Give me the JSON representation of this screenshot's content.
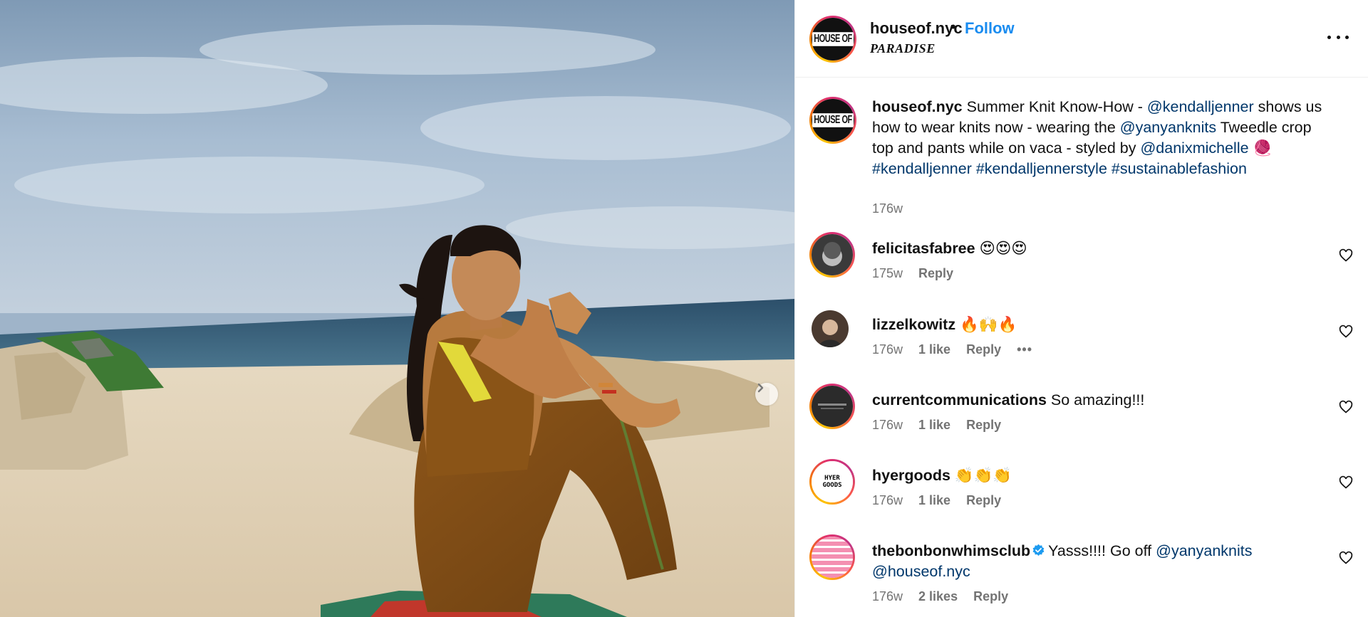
{
  "post": {
    "author": "houseof.nyc",
    "follow_label": "Follow",
    "separator": "•",
    "location": "PARADISE",
    "logo_text": "HOUSE OF",
    "more_icon": "more-horizontal-icon",
    "next_icon": "chevron-right-icon"
  },
  "caption": {
    "username": "houseof.nyc",
    "text_1": "Summer Knit Know-How - ",
    "mention_1": "@kendalljenner",
    "text_2": " shows us how to wear knits now - wearing the ",
    "mention_2": "@yanyanknits",
    "text_3": " Tweedle crop top and pants while on vaca - styled by ",
    "mention_3": "@danixmichelle",
    "emoji": "🧶",
    "hashtag_1": "#kendalljenner",
    "hashtag_2": "#kendalljennerstyle",
    "hashtag_3": "#sustainablefashion",
    "time": "176w"
  },
  "comments": [
    {
      "username": "felicitasfabree",
      "text": "😍😍😍",
      "time": "175w",
      "likes": "",
      "reply": "Reply"
    },
    {
      "username": "lizzelkowitz",
      "text": "🔥🙌🔥",
      "time": "176w",
      "likes": "1 like",
      "reply": "Reply",
      "more": "•••"
    },
    {
      "username": "currentcommunications",
      "text": "So amazing!!!",
      "time": "176w",
      "likes": "1 like",
      "reply": "Reply"
    },
    {
      "username": "hyergoods",
      "text": "👏👏👏",
      "time": "176w",
      "likes": "1 like",
      "reply": "Reply",
      "avatar_text": "HYER GOODS"
    },
    {
      "username": "thebonbonwhimsclub",
      "text_1": "Yasss!!!! Go off ",
      "mention_1": "@yanyanknits",
      "mention_2": "@houseof.nyc",
      "time": "176w",
      "likes": "2 likes",
      "reply": "Reply",
      "verified": true
    }
  ],
  "colors": {
    "follow": "#1a8cf0",
    "mention": "#00376b",
    "meta": "#737373",
    "verified": "#1d9bf0"
  }
}
